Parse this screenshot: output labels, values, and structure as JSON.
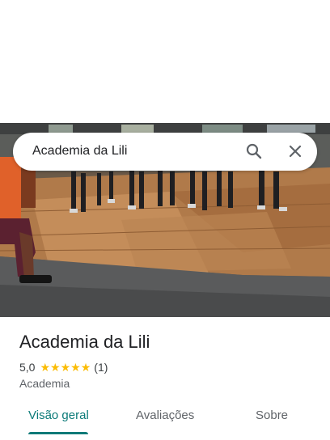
{
  "search": {
    "query": "Academia da Lili",
    "search_icon": "search-icon",
    "close_icon": "close-icon"
  },
  "photo": {
    "icon": "place-photo"
  },
  "place": {
    "name": "Academia da Lili",
    "rating": "5,0",
    "rating_value": 5,
    "stars": [
      "★",
      "★",
      "★",
      "★",
      "★"
    ],
    "review_count": "(1)",
    "category": "Academia"
  },
  "tabs": [
    {
      "label": "Visão geral",
      "active": true
    },
    {
      "label": "Avaliações",
      "active": false
    },
    {
      "label": "Sobre",
      "active": false
    }
  ],
  "colors": {
    "accent": "#0b7a78",
    "star": "#fbbc04"
  }
}
